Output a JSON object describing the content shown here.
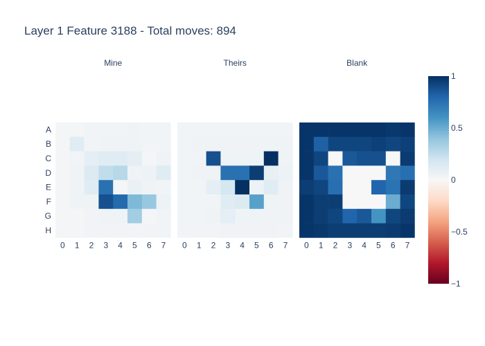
{
  "chart_data": {
    "type": "heatmap",
    "title": "Layer 1 Feature 3188 - Total moves: 894",
    "x_ticks": [
      "0",
      "1",
      "2",
      "3",
      "4",
      "5",
      "6",
      "7"
    ],
    "y_ticks": [
      "A",
      "B",
      "C",
      "D",
      "E",
      "F",
      "G",
      "H"
    ],
    "colorbar": {
      "min": -1,
      "max": 1,
      "ticks": [
        1,
        0.5,
        0,
        -0.5,
        -1
      ],
      "tick_labels": [
        "1",
        "0.5",
        "0",
        "−0.5",
        "−1"
      ]
    },
    "colorscale": "RdBu",
    "panels": [
      {
        "name": "Mine",
        "z": [
          [
            0.02,
            0.02,
            0.03,
            0.03,
            0.03,
            0.04,
            0.03,
            0.03
          ],
          [
            0.02,
            0.12,
            0.03,
            0.04,
            0.04,
            0.04,
            0.03,
            0.03
          ],
          [
            0.02,
            0.03,
            0.1,
            0.12,
            0.12,
            0.1,
            0.02,
            0.04
          ],
          [
            0.02,
            0.04,
            0.14,
            0.25,
            0.28,
            0.04,
            0.06,
            0.12
          ],
          [
            0.02,
            0.04,
            0.12,
            0.75,
            0.02,
            0.07,
            0.04,
            0.03
          ],
          [
            0.02,
            0.05,
            0.05,
            0.88,
            0.78,
            0.45,
            0.38,
            0.06
          ],
          [
            0.02,
            0.02,
            0.03,
            0.04,
            0.05,
            0.35,
            0.02,
            0.03
          ],
          [
            0.02,
            0.02,
            0.03,
            0.03,
            0.03,
            0.03,
            0.03,
            0.03
          ]
        ]
      },
      {
        "name": "Theirs",
        "z": [
          [
            0.03,
            0.03,
            0.03,
            0.03,
            0.03,
            0.03,
            0.03,
            0.03
          ],
          [
            0.03,
            0.04,
            0.04,
            0.04,
            0.04,
            0.04,
            0.05,
            0.04
          ],
          [
            0.03,
            0.03,
            0.88,
            0.05,
            0.05,
            0.05,
            1.0,
            0.05
          ],
          [
            0.03,
            0.04,
            0.05,
            0.75,
            0.75,
            0.95,
            0.08,
            0.06
          ],
          [
            0.03,
            0.03,
            0.1,
            0.18,
            1.0,
            0.06,
            0.12,
            0.04
          ],
          [
            0.03,
            0.03,
            0.03,
            0.12,
            0.14,
            0.55,
            0.05,
            0.04
          ],
          [
            0.03,
            0.03,
            0.04,
            0.1,
            0.05,
            0.05,
            0.04,
            0.04
          ],
          [
            0.03,
            0.03,
            0.03,
            0.04,
            0.04,
            0.04,
            0.04,
            0.03
          ]
        ]
      },
      {
        "name": "Blank",
        "z": [
          [
            0.98,
            0.98,
            0.98,
            0.98,
            0.98,
            0.98,
            0.97,
            0.98
          ],
          [
            0.98,
            0.82,
            0.92,
            0.92,
            0.92,
            0.94,
            0.92,
            0.94
          ],
          [
            0.98,
            0.92,
            0.0,
            0.85,
            0.88,
            0.88,
            0.0,
            0.96
          ],
          [
            0.98,
            0.85,
            0.75,
            0.0,
            0.0,
            0.0,
            0.72,
            0.76
          ],
          [
            0.95,
            0.92,
            0.76,
            0.0,
            0.0,
            0.8,
            0.74,
            0.96
          ],
          [
            0.98,
            0.95,
            0.95,
            0.0,
            0.0,
            0.0,
            0.5,
            0.92
          ],
          [
            0.98,
            0.95,
            0.92,
            0.8,
            0.85,
            0.6,
            0.92,
            0.96
          ],
          [
            0.98,
            0.97,
            0.95,
            0.95,
            0.95,
            0.95,
            0.96,
            0.98
          ]
        ]
      }
    ]
  }
}
